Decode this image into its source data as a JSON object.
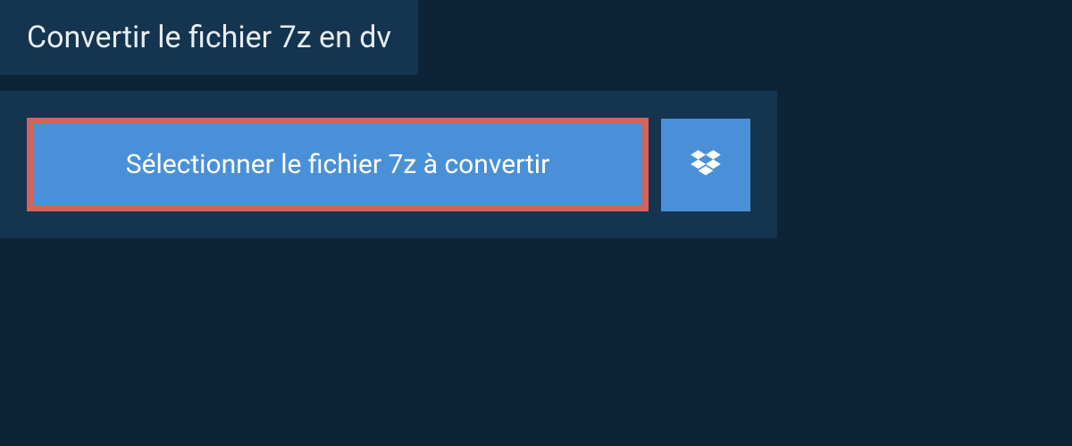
{
  "header": {
    "title": "Convertir le fichier 7z en dv"
  },
  "upload": {
    "select_button_label": "Sélectionner le fichier 7z à convertir"
  },
  "colors": {
    "background": "#0d2438",
    "panel": "#14344f",
    "button": "#4a90d9",
    "highlight_border": "#d66259",
    "text": "#e8edf2"
  }
}
